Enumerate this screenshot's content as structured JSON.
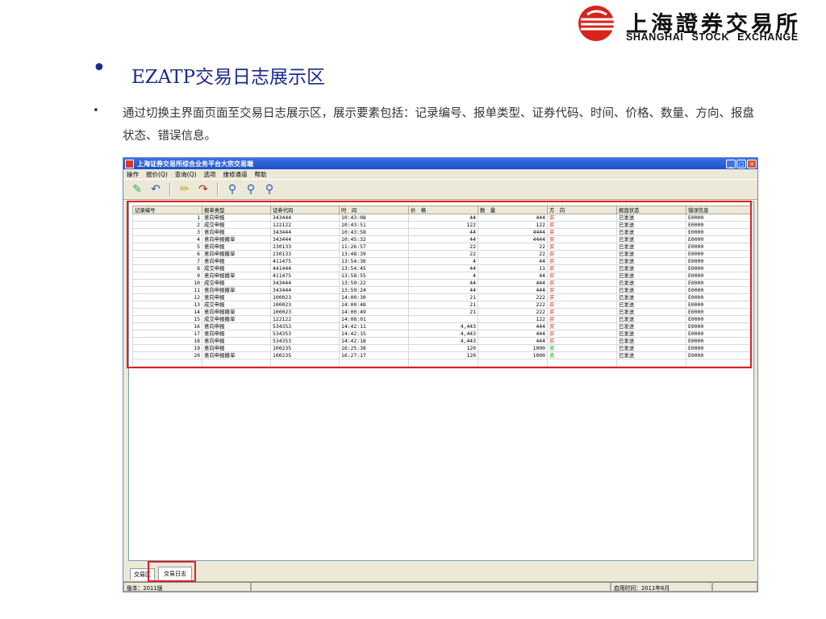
{
  "logo": {
    "cn": "上海證券交易所",
    "en": "SHANGHAI STOCK EXCHANGE"
  },
  "slide": {
    "title": "EZATP交易日志展示区",
    "description": "通过切换主界面页面至交易日志展示区，展示要素包括：记录编号、报单类型、证券代码、时间、价格、数量、方向、报盘状态、错误信息。"
  },
  "window": {
    "title": "上海证券交易所综合业务平台大宗交易端",
    "menu": [
      "操作",
      "报价(Q)",
      "查询(Q)",
      "选项",
      "维修通道",
      "帮助"
    ],
    "toolbar_icons": [
      "pen-icon",
      "undo-icon",
      "pencil-icon",
      "redo-icon",
      "search-group-icon",
      "zoom-icon",
      "search-icon"
    ],
    "columns": [
      "记录编号",
      "报单类型",
      "证券代码",
      "时　间",
      "价　格",
      "数　量",
      "方　向",
      "报盘状态",
      "错误信息"
    ],
    "rows": [
      [
        "1",
        "意向申报",
        "343444",
        "10:43:08",
        "44",
        "444",
        "买",
        "已发送",
        "E0000"
      ],
      [
        "2",
        "成交申报",
        "122122",
        "10:43:51",
        "122",
        "122",
        "买",
        "已发送",
        "E0000"
      ],
      [
        "3",
        "意向申报",
        "343444",
        "10:43:58",
        "44",
        "4444",
        "买",
        "已发送",
        "E0000"
      ],
      [
        "4",
        "意向申报撤单",
        "343444",
        "10:45:32",
        "44",
        "4444",
        "买",
        "已发送",
        "E0000"
      ],
      [
        "5",
        "意向申报",
        "230133",
        "11:26:57",
        "22",
        "22",
        "买",
        "已发送",
        "E0000"
      ],
      [
        "6",
        "意向申报撤单",
        "230133",
        "13:48:39",
        "22",
        "22",
        "买",
        "已发送",
        "E0000"
      ],
      [
        "7",
        "意向申报",
        "411475",
        "13:54:36",
        "4",
        "44",
        "买",
        "已发送",
        "E0000"
      ],
      [
        "8",
        "成交申报",
        "441444",
        "13:54:45",
        "44",
        "11",
        "买",
        "已发送",
        "E0000"
      ],
      [
        "9",
        "意向申报撤单",
        "411475",
        "13:58:55",
        "4",
        "44",
        "买",
        "已发送",
        "E0000"
      ],
      [
        "10",
        "成交申报",
        "343444",
        "13:59:22",
        "44",
        "444",
        "买",
        "已发送",
        "E0000"
      ],
      [
        "11",
        "意向申报撤单",
        "343444",
        "13:59:24",
        "44",
        "444",
        "买",
        "已发送",
        "E0000"
      ],
      [
        "12",
        "意向申报",
        "100023",
        "14:00:30",
        "21",
        "222",
        "买",
        "已发送",
        "E0000"
      ],
      [
        "13",
        "成交申报",
        "100023",
        "14:00:48",
        "21",
        "222",
        "买",
        "已发送",
        "E0000"
      ],
      [
        "14",
        "意向申报撤单",
        "100023",
        "14:00:49",
        "21",
        "222",
        "买",
        "已发送",
        "E0000"
      ],
      [
        "15",
        "成交申报撤单",
        "122122",
        "14:08:01",
        "",
        "122",
        "买",
        "已发送",
        "E0000"
      ],
      [
        "16",
        "意向申报",
        "534353",
        "14:42:11",
        "4,443",
        "444",
        "买",
        "已发送",
        "E0000"
      ],
      [
        "17",
        "意向申报",
        "534353",
        "14:42:15",
        "4,443",
        "444",
        "买",
        "已发送",
        "E0000"
      ],
      [
        "18",
        "意向申报",
        "534353",
        "14:42:18",
        "4,443",
        "444",
        "买",
        "已发送",
        "E0000"
      ],
      [
        "19",
        "意向申报",
        "100235",
        "16:25:38",
        "120",
        "1000",
        "卖",
        "已发送",
        "E0000"
      ],
      [
        "20",
        "意向申报撤单",
        "100235",
        "16:27:17",
        "120",
        "1000",
        "卖",
        "已发送",
        "E0000"
      ]
    ],
    "tabs": [
      "交易区",
      "交易日志"
    ],
    "status": {
      "version": "版本：2011版",
      "start_time": "启用时间：2011年6月"
    }
  },
  "colors": {
    "title": "#1a2a8c",
    "highlight": "#e02020",
    "buy": "#d21111",
    "sell": "#1a9a1a"
  }
}
